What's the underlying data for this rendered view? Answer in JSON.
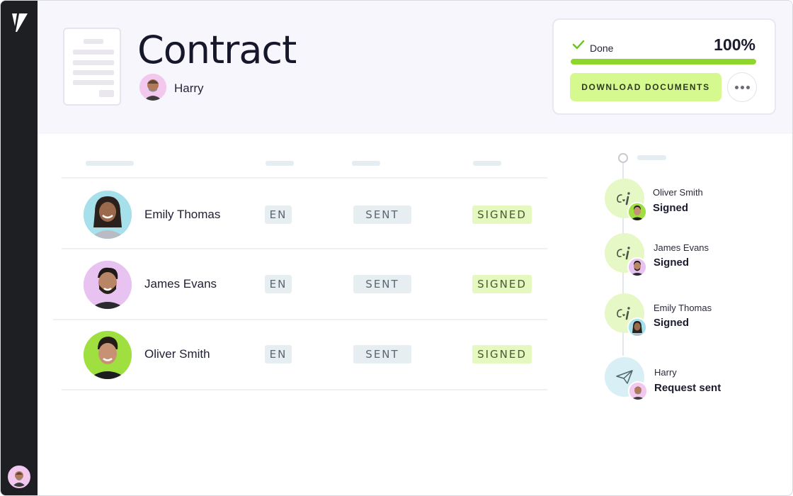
{
  "document": {
    "title": "Contract",
    "owner_name": "Harry"
  },
  "status": {
    "label": "Done",
    "percent_text": "100%",
    "progress": 1.0,
    "download_label": "DOWNLOAD DOCUMENTS",
    "more_icon": "ellipsis-icon"
  },
  "signers": [
    {
      "name": "Emily Thomas",
      "language": "EN",
      "sent": "SENT",
      "status": "SIGNED",
      "avatar_color": "#a6e0ea"
    },
    {
      "name": "James Evans",
      "language": "EN",
      "sent": "SENT",
      "status": "SIGNED",
      "avatar_color": "#e8c3f2"
    },
    {
      "name": "Oliver Smith",
      "language": "EN",
      "sent": "SENT",
      "status": "SIGNED",
      "avatar_color": "#9fe040"
    }
  ],
  "timeline": [
    {
      "name": "Oliver Smith",
      "status": "Signed",
      "icon": "signature-icon",
      "avatar_color": "#9fe040"
    },
    {
      "name": "James Evans",
      "status": "Signed",
      "icon": "signature-icon",
      "avatar_color": "#e8c3f2"
    },
    {
      "name": "Emily Thomas",
      "status": "Signed",
      "icon": "signature-icon",
      "avatar_color": "#a6e0ea"
    },
    {
      "name": "Harry",
      "status": "Request sent",
      "icon": "paper-plane-icon",
      "avatar_color": "#f3c8ef"
    }
  ],
  "colors": {
    "sidebar": "#1e1f23",
    "accent_green": "#d6f98f",
    "progress_green": "#8fd62b",
    "header_bg": "#f7f6fc"
  }
}
